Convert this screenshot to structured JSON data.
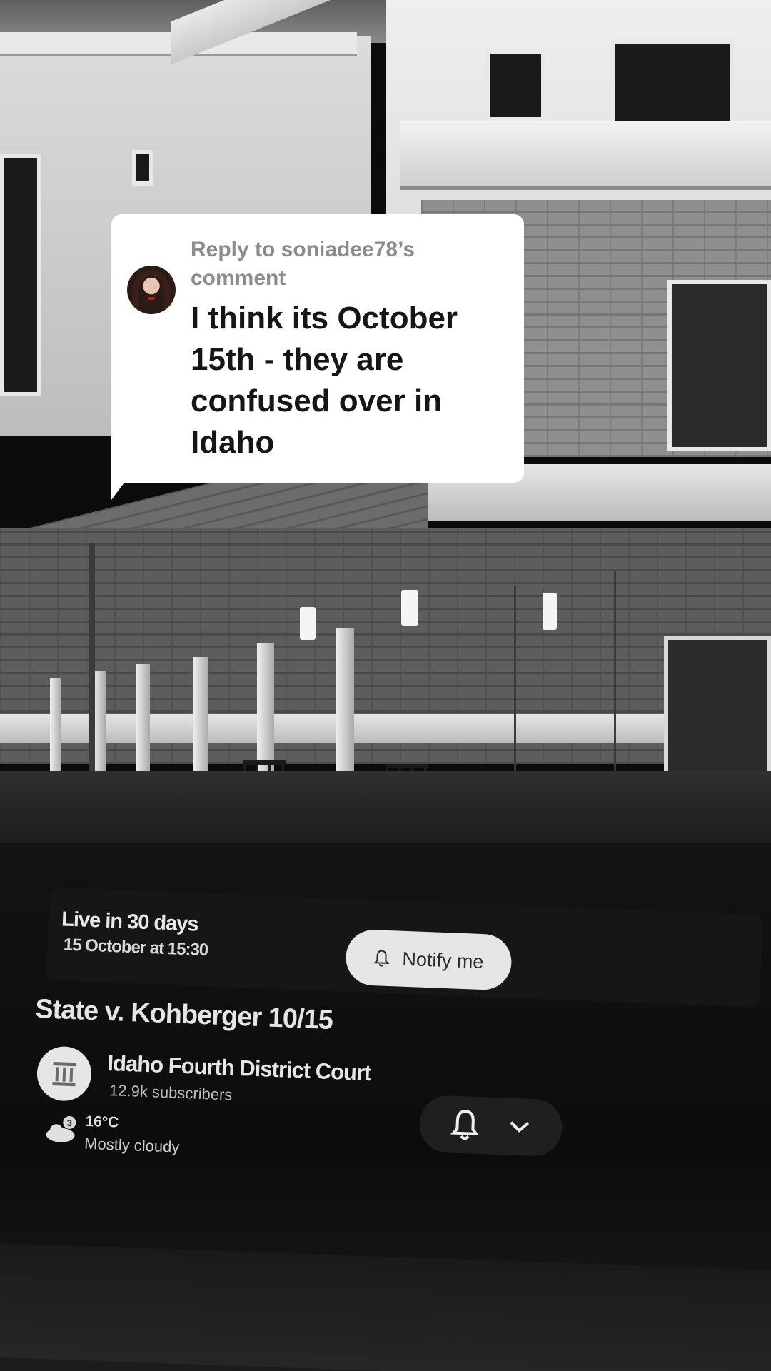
{
  "reply_sticker": {
    "header": "Reply to soniadee78’s comment",
    "comment": "I think its October 15th - they are confused over in Idaho"
  },
  "stream_card": {
    "live_status": "Live in 30 days",
    "scheduled": "15 October at 15:30",
    "notify_label": "Notify me"
  },
  "video": {
    "title": "State v. Kohberger 10/15",
    "channel_name": "Idaho Fourth District Court",
    "subscribers": "12.9k subscribers"
  },
  "weather": {
    "badge": "3",
    "temperature": "16°C",
    "condition": "Mostly cloudy"
  },
  "colors": {
    "sticker_bg": "#ffffff",
    "sticker_header": "#8d8d8d",
    "sticker_text": "#161616",
    "notify_button": "#e6e6e6"
  }
}
